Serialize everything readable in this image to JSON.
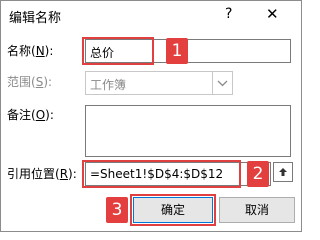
{
  "dialog": {
    "title": "编辑名称",
    "help_label": "?",
    "close_label": "✕"
  },
  "name_field": {
    "label_prefix": "名称(",
    "label_mnemonic": "N",
    "label_suffix": "):",
    "value": "总价"
  },
  "scope_field": {
    "label_prefix": "范围(",
    "label_mnemonic": "S",
    "label_suffix": "):",
    "value": "工作簿",
    "icon": "chevron-down-icon"
  },
  "comment_field": {
    "label_prefix": "备注(",
    "label_mnemonic": "O",
    "label_suffix": "):",
    "value": ""
  },
  "refers_to_field": {
    "label_prefix": "引用位置(",
    "label_mnemonic": "R",
    "label_suffix": "):",
    "value": "=Sheet1!$D$4:$D$12",
    "collapse_icon": "collapse-arrow-icon"
  },
  "buttons": {
    "ok_label": "确定",
    "cancel_label": "取消"
  },
  "annotations": {
    "marker_1": "1",
    "marker_2": "2",
    "marker_3": "3",
    "color": "#e23f3e"
  }
}
